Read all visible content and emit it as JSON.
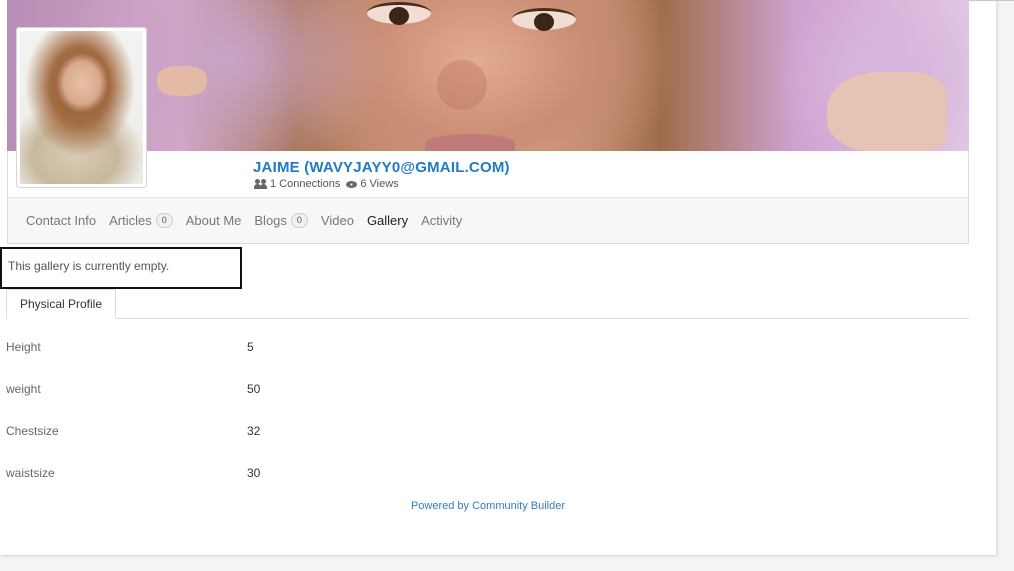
{
  "profile": {
    "name": "JAIME (WAVYJAYY0@GMAIL.COM)",
    "connections": "1 Connections",
    "views": "6 Views"
  },
  "tabs": [
    {
      "label": "Contact Info"
    },
    {
      "label": "Articles",
      "badge": "0"
    },
    {
      "label": "About Me"
    },
    {
      "label": "Blogs",
      "badge": "0"
    },
    {
      "label": "Video"
    },
    {
      "label": "Gallery",
      "active": true
    },
    {
      "label": "Activity"
    }
  ],
  "gallery": {
    "empty_message": "This gallery is currently empty."
  },
  "physical_profile": {
    "tab_label": "Physical Profile",
    "fields": [
      {
        "label": "Height",
        "value": "5"
      },
      {
        "label": "weight",
        "value": "50"
      },
      {
        "label": "Chestsize",
        "value": "32"
      },
      {
        "label": "waistsize",
        "value": "30"
      }
    ]
  },
  "footer": {
    "powered_by": "Powered by Community Builder"
  },
  "colors": {
    "name": "#1f7ac7",
    "link": "#2f7ec1"
  }
}
